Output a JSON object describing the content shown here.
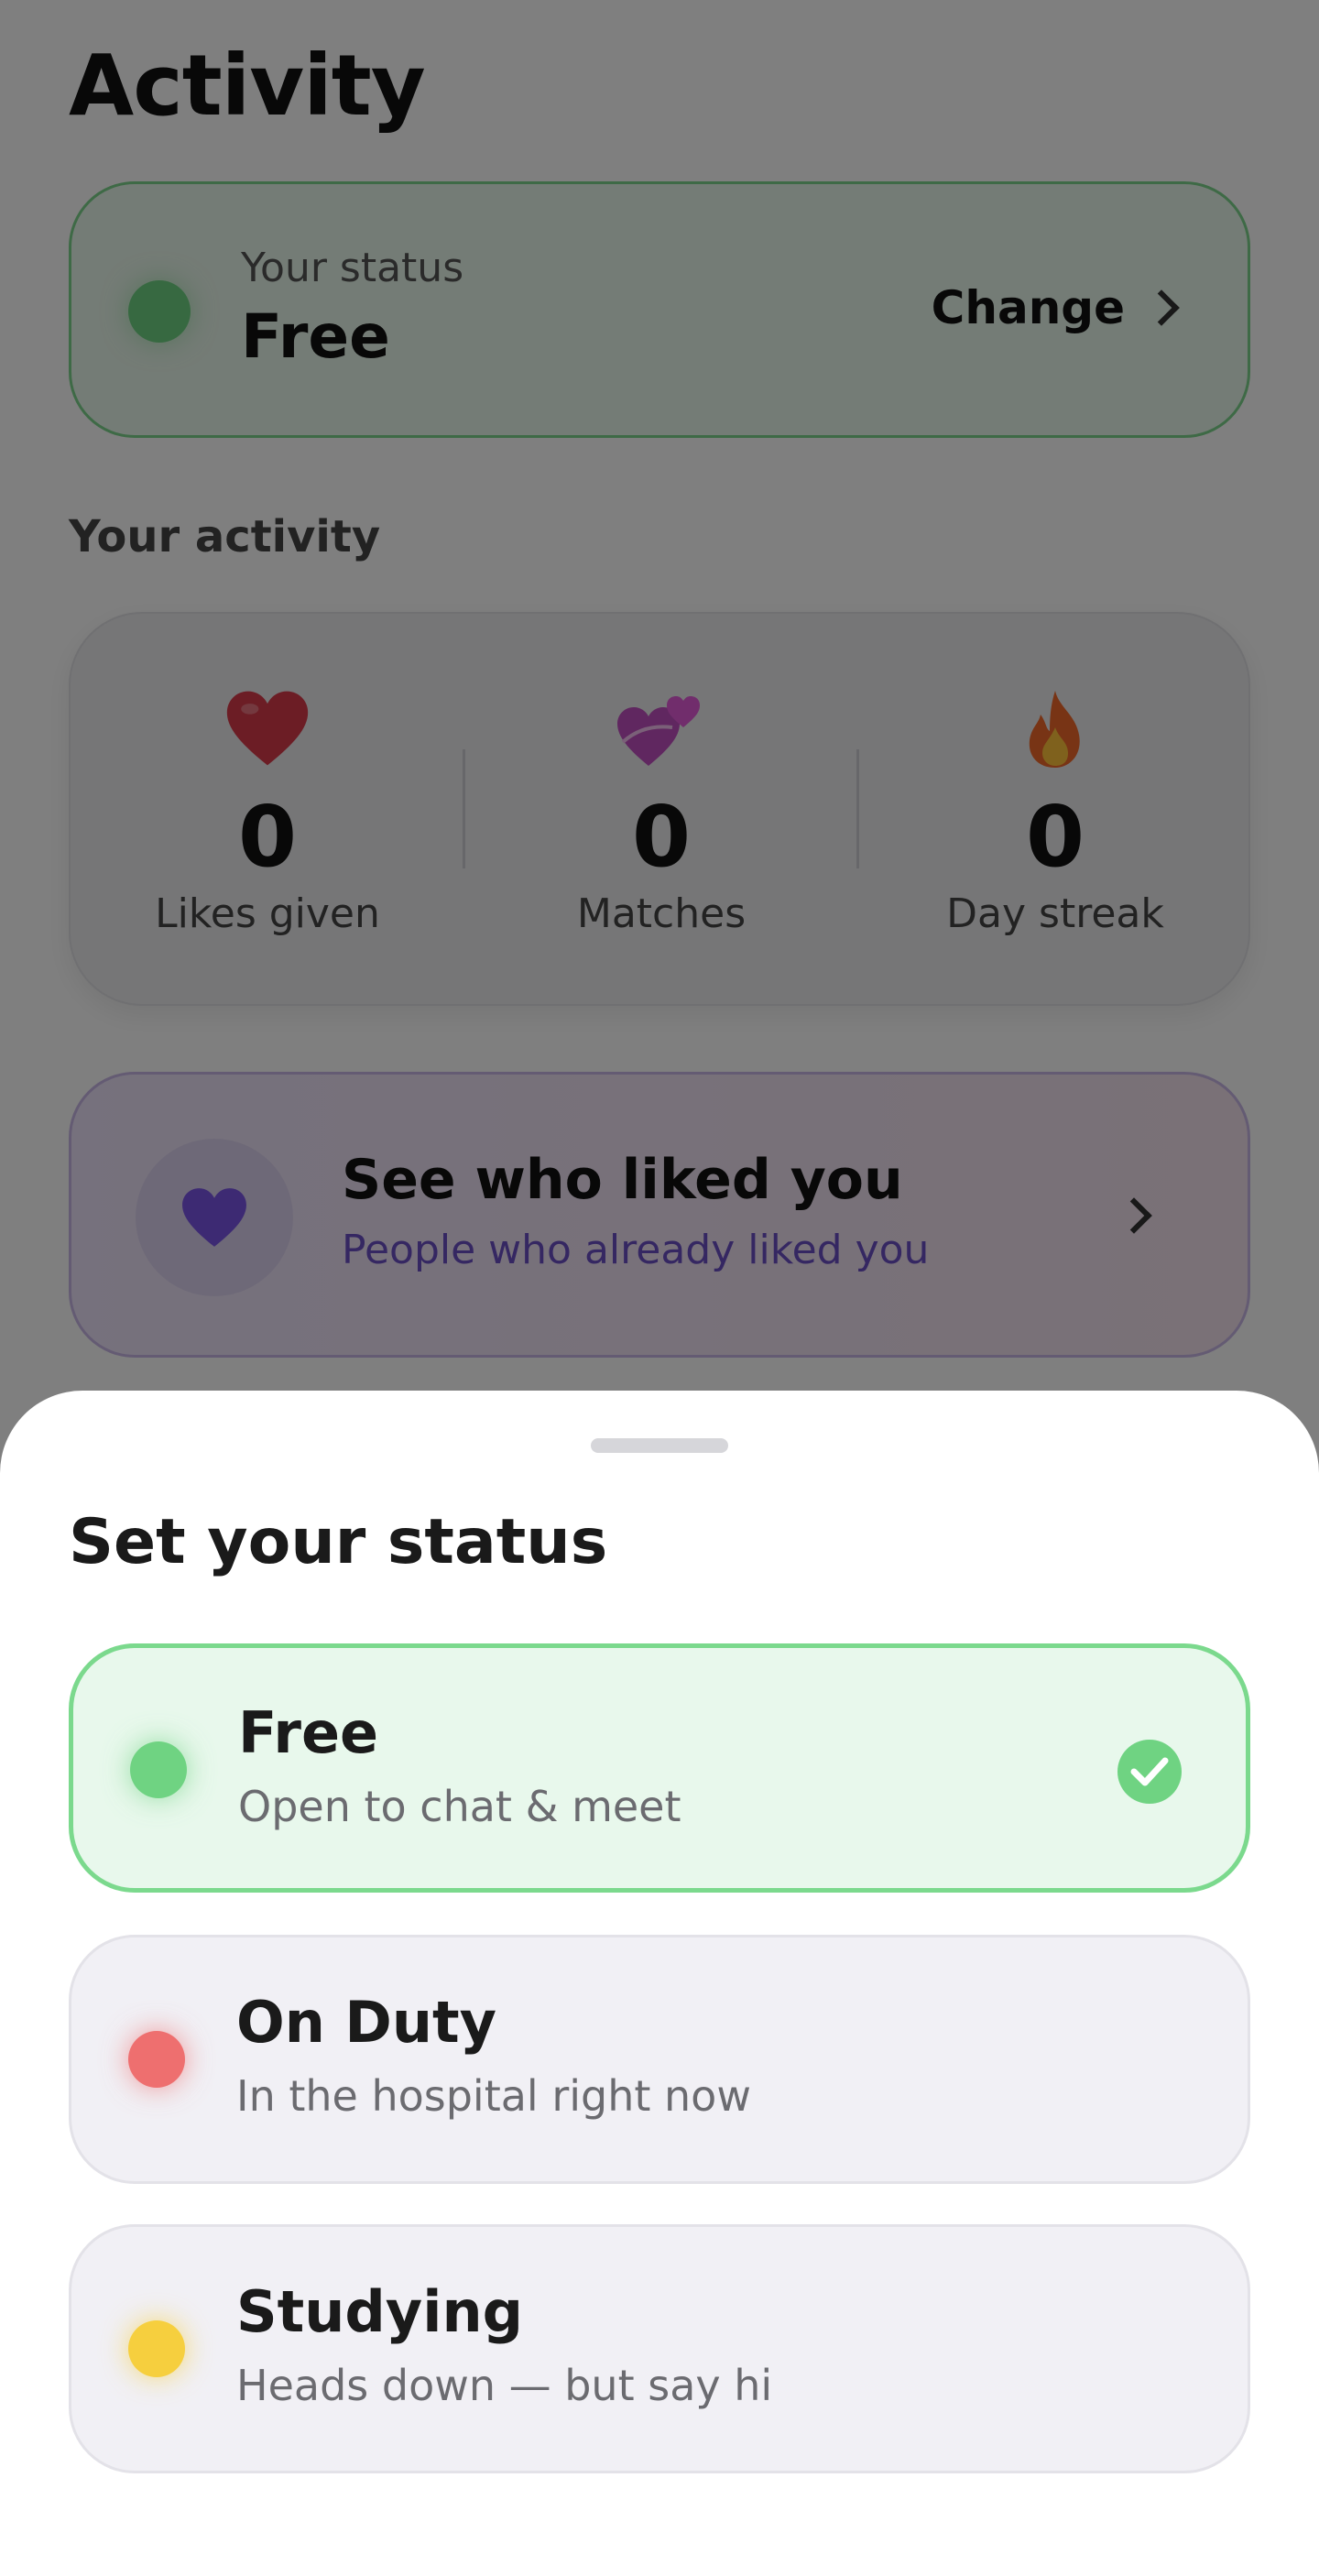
{
  "page": {
    "title": "Activity",
    "status_card": {
      "label": "Your status",
      "value": "Free",
      "change_label": "Change",
      "dot_color": "#6fd382"
    },
    "activity_section_label": "Your activity",
    "stats": [
      {
        "icon": "red-heart-icon",
        "value": "0",
        "label": "Likes given"
      },
      {
        "icon": "two-hearts-icon",
        "value": "0",
        "label": "Matches"
      },
      {
        "icon": "fire-icon",
        "value": "0",
        "label": "Day streak"
      }
    ],
    "liked_card": {
      "icon": "purple-heart-icon",
      "title": "See who liked you",
      "subtitle": "People who already liked you"
    }
  },
  "sheet": {
    "title": "Set your status",
    "options": [
      {
        "title": "Free",
        "subtitle": "Open to chat & meet",
        "dot_color": "#6fd382",
        "selected": true
      },
      {
        "title": "On Duty",
        "subtitle": "In the hospital right now",
        "dot_color": "#ee6f6f",
        "selected": false
      },
      {
        "title": "Studying",
        "subtitle": "Heads down — but say hi",
        "dot_color": "#f6cf3e",
        "selected": false
      }
    ]
  },
  "colors": {
    "overlay": "rgba(0,0,0,0.5)",
    "accent_green": "#7bd98d",
    "accent_purple": "#6b4fc4"
  }
}
